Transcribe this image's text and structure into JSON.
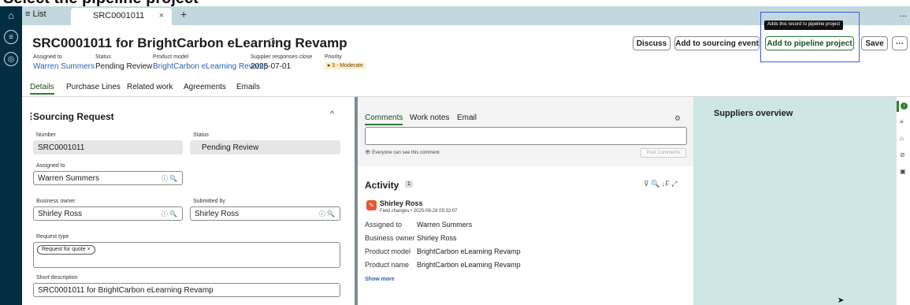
{
  "banner": {
    "text": "Select the pipeline project"
  },
  "tabs": {
    "list_label": "≡ List",
    "active_tab": "SRC0001011",
    "close": "×",
    "add": "+",
    "more": "..."
  },
  "record": {
    "title": "SRC0001011 for BrightCarbon eLearning Revamp",
    "meta": {
      "assigned_to_label": "Assigned to",
      "assigned_to": "Warren Summers",
      "status_label": "Status",
      "status": "Pending Review",
      "product_model_label": "Product model",
      "product_model": "BrightCarbon eLearning Revamp",
      "supplier_close_label": "Supplier responses close",
      "supplier_close": "2025-07-01",
      "priority_label": "Priority",
      "priority": "● 3 - Moderate"
    }
  },
  "actions": {
    "discuss": "Discuss",
    "add_sourcing": "Add to sourcing event",
    "add_pipeline": "Add to pipeline project",
    "save": "Save",
    "more": "···",
    "tooltip": "Adds this record to pipeline project"
  },
  "subtabs": [
    "Details",
    "Purchase Lines",
    "Related work",
    "Agreements",
    "Emails"
  ],
  "form": {
    "section_title": "Sourcing Request",
    "number_label": "Number",
    "number": "SRC0001011",
    "status_label": "Status",
    "status": "Pending Review",
    "assigned_label": "Assigned to",
    "assigned": "Warren Summers",
    "owner_label": "Business owner",
    "owner": "Shirley Ross",
    "submitted_label": "Submitted by",
    "submitted": "Shirley Ross",
    "request_type_label": "Request type",
    "request_type_chip": "Request for quote ×",
    "short_desc_label": "Short description",
    "short_desc": "SRC0001011 for BrightCarbon eLearning Revamp",
    "field_icons": "ⓘ  🔍"
  },
  "comments": {
    "tabs": [
      "Comments",
      "Work notes",
      "Email"
    ],
    "visibility_note": "👁 Everyone can see this comment",
    "post_button": "Post Comments"
  },
  "activity": {
    "title": "Activity",
    "count": "1",
    "icons": "⊽   🔍   ↓F   ⤢",
    "author": "Shirley Ross",
    "sub": "Field changes • 2025-06-28 09:32:07",
    "rows": [
      {
        "k": "Assigned to",
        "v": "Warren Summers"
      },
      {
        "k": "Business owner",
        "v": "Shirley Ross"
      },
      {
        "k": "Product model",
        "v": "BrightCarbon eLearning Revamp"
      },
      {
        "k": "Product name",
        "v": "BrightCarbon eLearning Revamp"
      }
    ],
    "show_more": "Show more"
  },
  "suppliers": {
    "title": "Suppliers overview"
  }
}
